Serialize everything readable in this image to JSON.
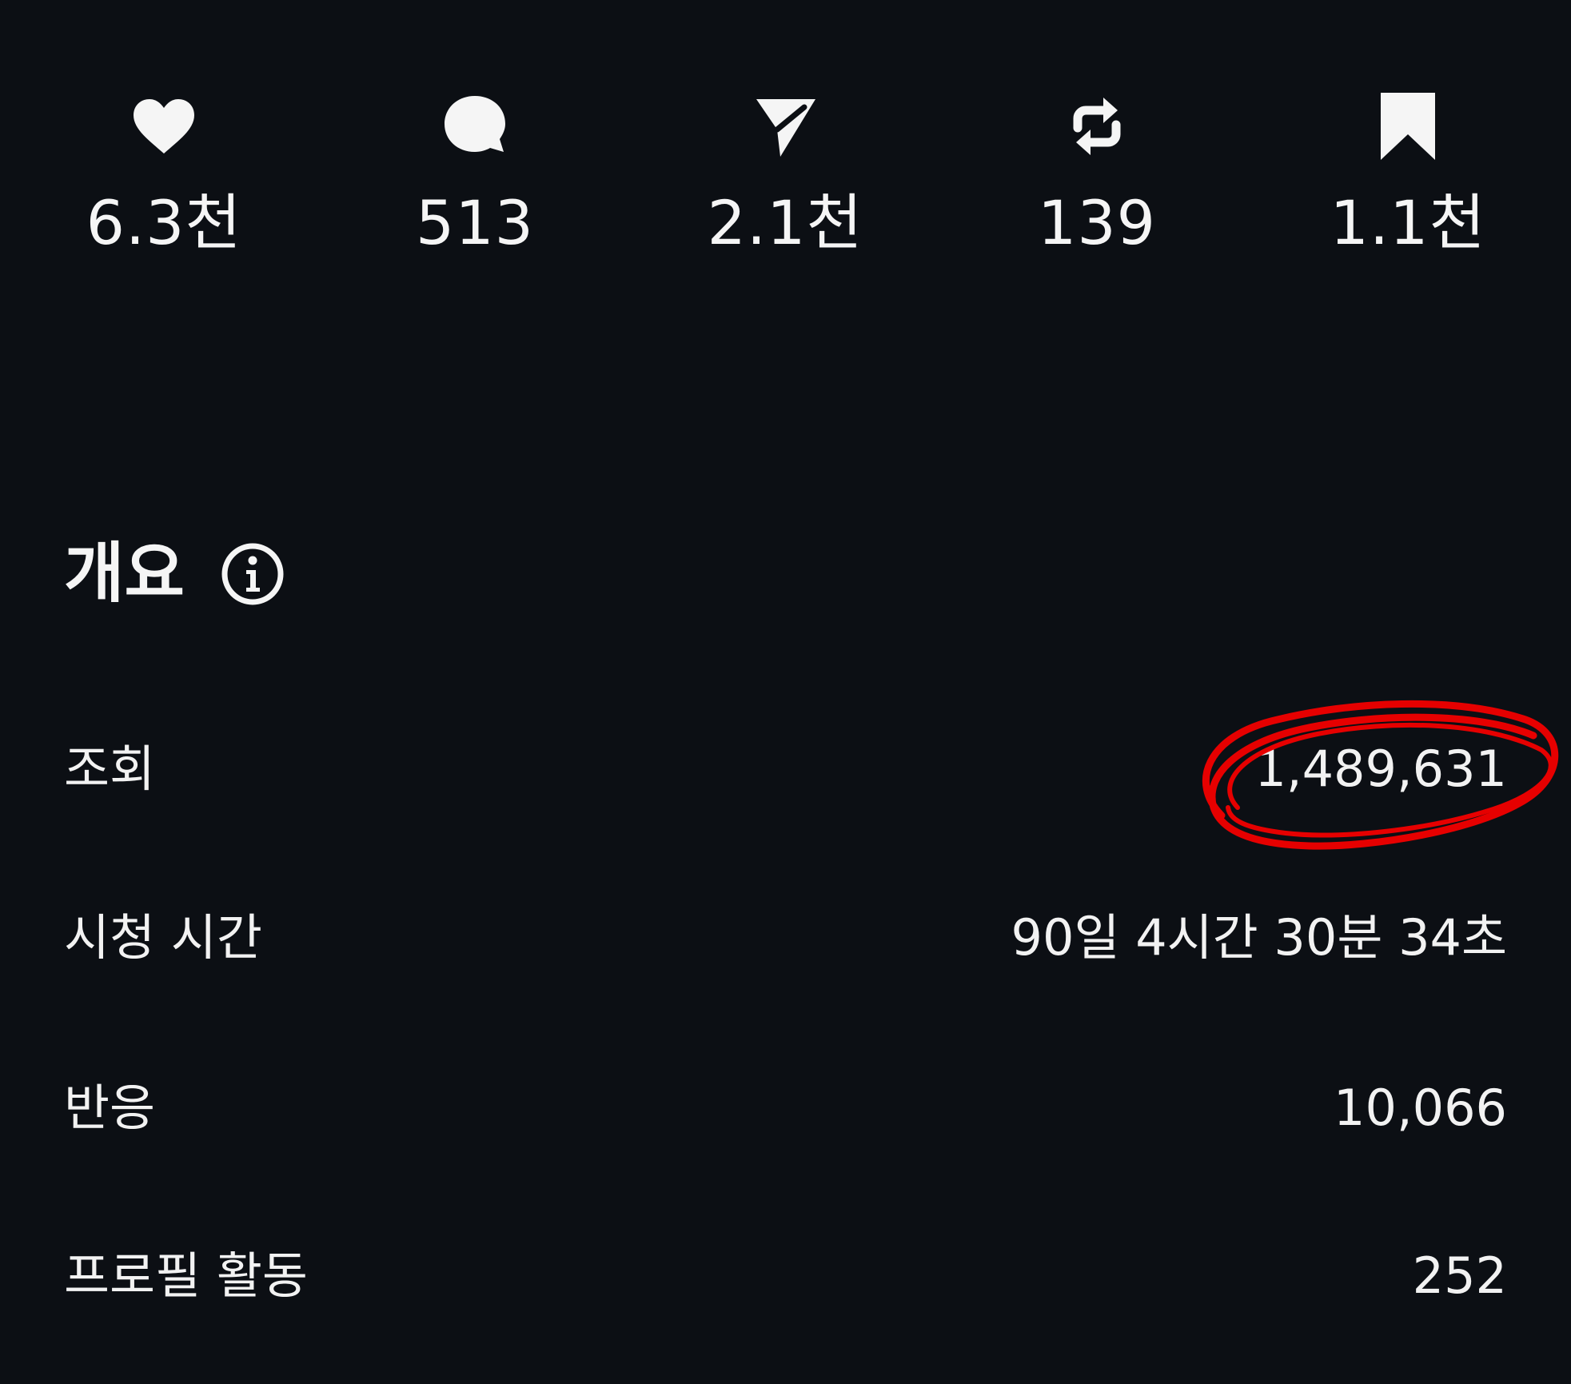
{
  "actions": [
    {
      "icon": "heart-icon",
      "count": "6.3천"
    },
    {
      "icon": "comment-icon",
      "count": "513"
    },
    {
      "icon": "send-icon",
      "count": "2.1천"
    },
    {
      "icon": "repost-icon",
      "count": "139"
    },
    {
      "icon": "bookmark-icon",
      "count": "1.1천"
    }
  ],
  "overview": {
    "title": "개요",
    "info_icon": "info-icon",
    "stats": [
      {
        "label": "조회",
        "value": "1,489,631"
      },
      {
        "label": "시청 시간",
        "value": "90일 4시간 30분 34초"
      },
      {
        "label": "반응",
        "value": "10,066"
      },
      {
        "label": "프로필 활동",
        "value": "252"
      }
    ]
  },
  "colors": {
    "background": "#0c0f14",
    "text": "#f2f2f2",
    "annotation": "#e60000"
  }
}
